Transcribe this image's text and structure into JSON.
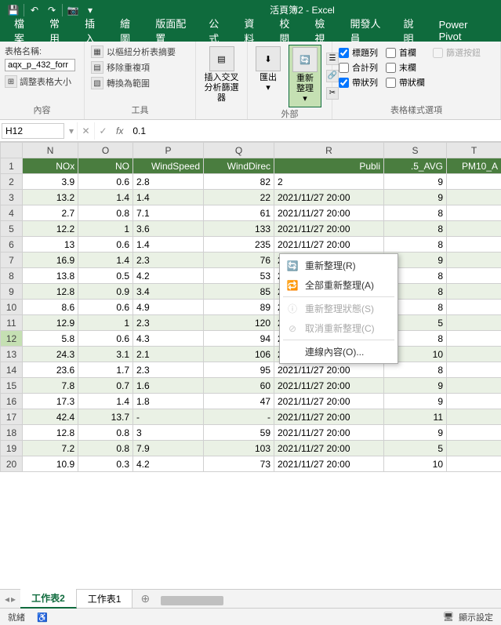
{
  "app": {
    "title": "活頁簿2 - Excel"
  },
  "qat": {
    "save": "save",
    "undo": "undo",
    "redo": "redo",
    "camera": "camera"
  },
  "tabs": [
    "檔案",
    "常用",
    "插入",
    "繪圖",
    "版面配置",
    "公式",
    "資料",
    "校閱",
    "檢視",
    "開發人員",
    "說明",
    "Power Pivot"
  ],
  "ribbon": {
    "tableName": {
      "label": "表格名稱:",
      "value": "aqx_p_432_forr",
      "resize": "調整表格大小",
      "group": "內容"
    },
    "tools": {
      "pivot": "以樞紐分析表摘要",
      "dedup": "移除重複項",
      "convert": "轉換為範圍",
      "group": "工具",
      "slicer": "插入交叉分析篩選器",
      "export": "匯出",
      "refresh": "重新整理",
      "extGroup": "外部"
    },
    "styleOptions": {
      "headerRow": "標題列",
      "totalRow": "合計列",
      "banded": "帶狀列",
      "firstCol": "首欄",
      "lastCol": "末欄",
      "bandedCol": "帶狀欄",
      "filterBtn": "篩選按鈕",
      "group": "表格樣式選項"
    }
  },
  "menu": {
    "refresh": "重新整理(R)",
    "refreshAll": "全部重新整理(A)",
    "refreshStatus": "重新整理狀態(S)",
    "cancelRefresh": "取消重新整理(C)",
    "connProps": "連線內容(O)..."
  },
  "formulaBar": {
    "name": "H12",
    "value": "0.1"
  },
  "columns": [
    "",
    "N",
    "O",
    "P",
    "Q",
    "R",
    "S",
    "T"
  ],
  "headers": [
    "NOx",
    "NO",
    "WindSpeed",
    "WindDirec",
    "Publi",
    ".5_AVG",
    "PM10_A"
  ],
  "rows": [
    {
      "r": 2,
      "nox": "3.9",
      "no": "0.6",
      "ws": "2.8",
      "wd": "82",
      "pub": "2",
      "avg": "9",
      "pm": ""
    },
    {
      "r": 3,
      "nox": "13.2",
      "no": "1.4",
      "ws": "1.4",
      "wd": "22",
      "pub": "2021/11/27 20:00",
      "avg": "9",
      "pm": ""
    },
    {
      "r": 4,
      "nox": "2.7",
      "no": "0.8",
      "ws": "7.1",
      "wd": "61",
      "pub": "2021/11/27 20:00",
      "avg": "8",
      "pm": ""
    },
    {
      "r": 5,
      "nox": "12.2",
      "no": "1",
      "ws": "3.6",
      "wd": "133",
      "pub": "2021/11/27 20:00",
      "avg": "8",
      "pm": ""
    },
    {
      "r": 6,
      "nox": "13",
      "no": "0.6",
      "ws": "1.4",
      "wd": "235",
      "pub": "2021/11/27 20:00",
      "avg": "8",
      "pm": ""
    },
    {
      "r": 7,
      "nox": "16.9",
      "no": "1.4",
      "ws": "2.3",
      "wd": "76",
      "pub": "2021/11/27 20:00",
      "avg": "9",
      "pm": ""
    },
    {
      "r": 8,
      "nox": "13.8",
      "no": "0.5",
      "ws": "4.2",
      "wd": "53",
      "pub": "2021/11/27 20:00",
      "avg": "8",
      "pm": ""
    },
    {
      "r": 9,
      "nox": "12.8",
      "no": "0.9",
      "ws": "3.4",
      "wd": "85",
      "pub": "2021/11/27 20:00",
      "avg": "8",
      "pm": ""
    },
    {
      "r": 10,
      "nox": "8.6",
      "no": "0.6",
      "ws": "4.9",
      "wd": "89",
      "pub": "2021/11/27 20:00",
      "avg": "8",
      "pm": ""
    },
    {
      "r": 11,
      "nox": "12.9",
      "no": "1",
      "ws": "2.3",
      "wd": "120",
      "pub": "2021/11/27 20:00",
      "avg": "5",
      "pm": ""
    },
    {
      "r": 12,
      "nox": "5.8",
      "no": "0.6",
      "ws": "4.3",
      "wd": "94",
      "pub": "2021/11/27 20:00",
      "avg": "8",
      "pm": ""
    },
    {
      "r": 13,
      "nox": "24.3",
      "no": "3.1",
      "ws": "2.1",
      "wd": "106",
      "pub": "2021/11/27 20:00",
      "avg": "10",
      "pm": ""
    },
    {
      "r": 14,
      "nox": "23.6",
      "no": "1.7",
      "ws": "2.3",
      "wd": "95",
      "pub": "2021/11/27 20:00",
      "avg": "8",
      "pm": ""
    },
    {
      "r": 15,
      "nox": "7.8",
      "no": "0.7",
      "ws": "1.6",
      "wd": "60",
      "pub": "2021/11/27 20:00",
      "avg": "9",
      "pm": ""
    },
    {
      "r": 16,
      "nox": "17.3",
      "no": "1.4",
      "ws": "1.8",
      "wd": "47",
      "pub": "2021/11/27 20:00",
      "avg": "9",
      "pm": ""
    },
    {
      "r": 17,
      "nox": "42.4",
      "no": "13.7",
      "ws": "-",
      "wd": "-",
      "pub": "2021/11/27 20:00",
      "avg": "11",
      "pm": ""
    },
    {
      "r": 18,
      "nox": "12.8",
      "no": "0.8",
      "ws": "3",
      "wd": "59",
      "pub": "2021/11/27 20:00",
      "avg": "9",
      "pm": ""
    },
    {
      "r": 19,
      "nox": "7.2",
      "no": "0.8",
      "ws": "7.9",
      "wd": "103",
      "pub": "2021/11/27 20:00",
      "avg": "5",
      "pm": ""
    },
    {
      "r": 20,
      "nox": "10.9",
      "no": "0.3",
      "ws": "4.2",
      "wd": "73",
      "pub": "2021/11/27 20:00",
      "avg": "10",
      "pm": ""
    }
  ],
  "sheets": {
    "s1": "工作表2",
    "s2": "工作表1"
  },
  "status": {
    "ready": "就緒",
    "access": "",
    "display": "顯示設定"
  }
}
